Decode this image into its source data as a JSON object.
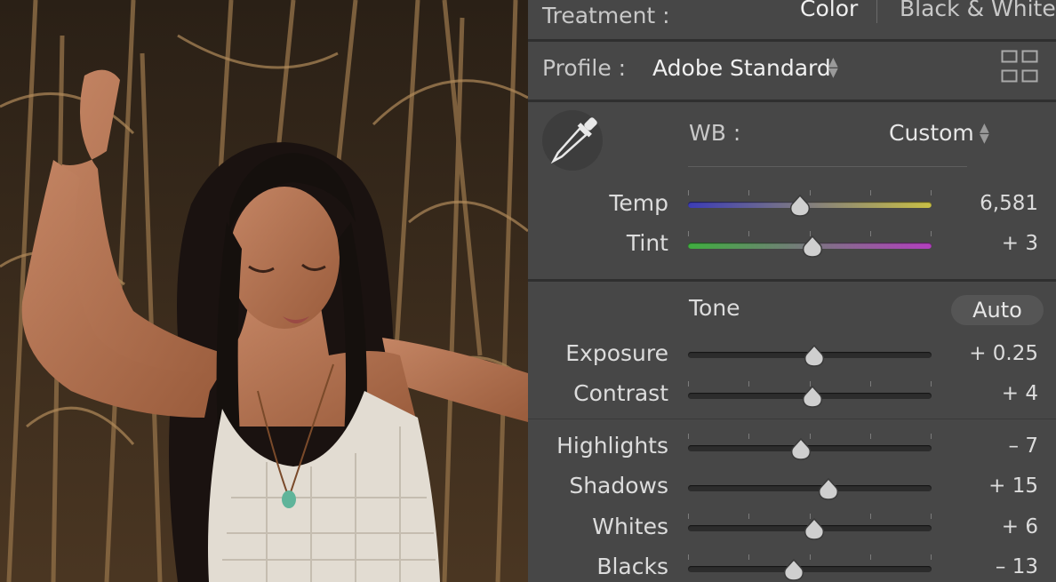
{
  "treatment": {
    "label": "Treatment :",
    "options": [
      "Color",
      "Black & White"
    ]
  },
  "profile": {
    "label": "Profile :",
    "value": "Adobe Standard",
    "grid_icon": "grid-icon"
  },
  "wb": {
    "label": "WB :",
    "value": "Custom",
    "eyedropper_icon": "eyedropper-icon"
  },
  "temp": {
    "label": "Temp",
    "value": "6,581",
    "position": 0.46,
    "gradient": [
      "#3c3cb6",
      "#c9c045"
    ]
  },
  "tint": {
    "label": "Tint",
    "value": "+ 3",
    "position": 0.51,
    "gradient": [
      "#3fae3f",
      "#b33fbf"
    ]
  },
  "tone": {
    "heading": "Tone",
    "auto_label": "Auto"
  },
  "sliders": [
    {
      "id": "exposure",
      "label": "Exposure",
      "value": "+ 0.25",
      "position": 0.52
    },
    {
      "id": "contrast",
      "label": "Contrast",
      "value": "+ 4",
      "position": 0.51
    },
    {
      "id": "highlights",
      "label": "Highlights",
      "value": "– 7",
      "position": 0.465
    },
    {
      "id": "shadows",
      "label": "Shadows",
      "value": "+ 15",
      "position": 0.575
    },
    {
      "id": "whites",
      "label": "Whites",
      "value": "+ 6",
      "position": 0.52
    },
    {
      "id": "blacks",
      "label": "Blacks",
      "value": "– 13",
      "position": 0.435
    }
  ]
}
